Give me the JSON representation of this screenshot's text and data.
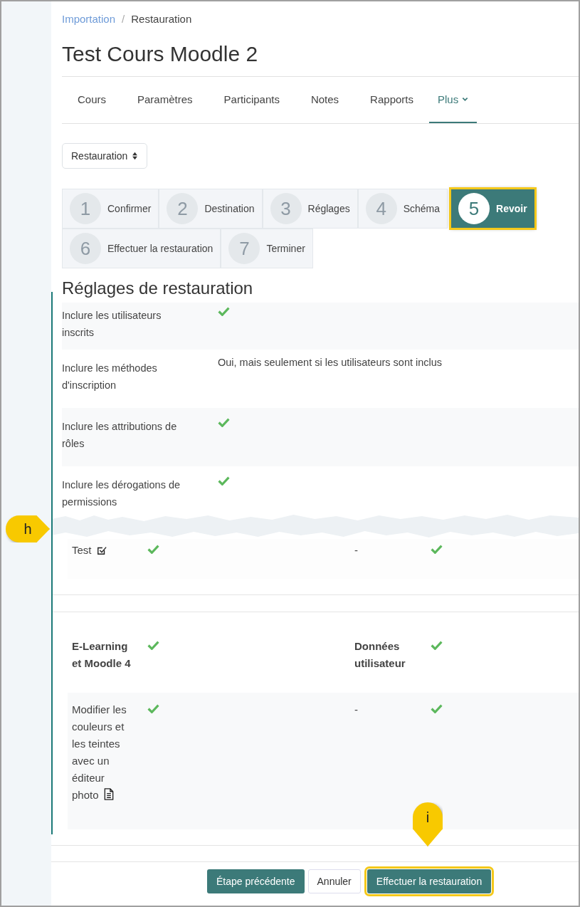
{
  "breadcrumb": [
    {
      "label": "Importation",
      "link": true
    },
    {
      "label": "Restauration",
      "link": false
    }
  ],
  "breadcrumb_separator": "/",
  "title": "Test Cours Moodle 2",
  "nav_tabs": [
    {
      "label": "Cours",
      "selected": false
    },
    {
      "label": "Paramètres",
      "selected": false
    },
    {
      "label": "Participants",
      "selected": false
    },
    {
      "label": "Notes",
      "selected": false
    },
    {
      "label": "Rapports",
      "selected": false
    },
    {
      "label": "Plus",
      "selected": true,
      "dropdown": true
    }
  ],
  "page_select": {
    "value": "Restauration"
  },
  "steps": [
    {
      "number": "1",
      "label": "Confirmer",
      "selected": false
    },
    {
      "number": "2",
      "label": "Destination",
      "selected": false
    },
    {
      "number": "3",
      "label": "Réglages",
      "selected": false
    },
    {
      "number": "4",
      "label": "Schéma",
      "selected": false
    },
    {
      "number": "5",
      "label": "Revoir",
      "selected": true
    },
    {
      "number": "6",
      "label": "Effectuer la restauration",
      "selected": false
    },
    {
      "number": "7",
      "label": "Terminer",
      "selected": false
    }
  ],
  "section_heading": "Réglages de restauration",
  "settings": [
    {
      "label": "Inclure les utilisateurs inscrits",
      "kind": "check"
    },
    {
      "label": "Inclure les méthodes d'inscription",
      "kind": "text",
      "value": "Oui, mais seulement si les utilisateurs sont inclus"
    },
    {
      "label": "Inclure les attributions de rôles",
      "kind": "check"
    },
    {
      "label": "Inclure les dérogations de permissions",
      "kind": "check"
    }
  ],
  "activities_top": [
    {
      "name": "Test",
      "kind": "task",
      "included": true,
      "userdata": "-",
      "userdata_included": true
    }
  ],
  "section": {
    "name": "E-Learning et Moodle 4",
    "included": true,
    "userdata_label": "Données utilisateur",
    "userdata_included": true
  },
  "activities": [
    {
      "name": "Modifier les couleurs et les teintes avec un éditeur photo",
      "kind": "document",
      "included": true,
      "userdata": "-",
      "userdata_included": true
    }
  ],
  "buttons": [
    {
      "label": "Étape précédente",
      "kind": "secondary",
      "highlighted": false
    },
    {
      "label": "Annuler",
      "kind": "plain",
      "highlighted": false
    },
    {
      "label": "Effectuer la restauration",
      "kind": "primary",
      "highlighted": true
    }
  ],
  "callouts": [
    {
      "label": "h",
      "kind": "left"
    },
    {
      "label": "i",
      "kind": "down"
    }
  ]
}
